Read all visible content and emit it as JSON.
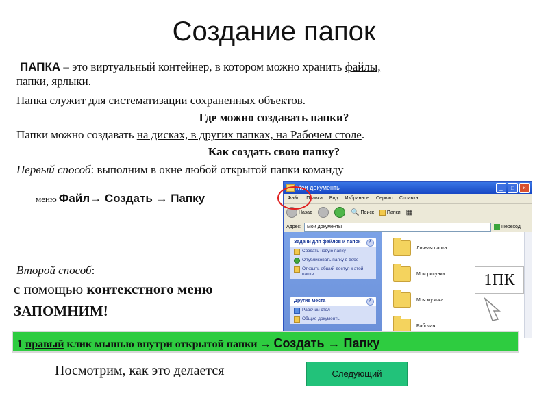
{
  "title": "Создание папок",
  "para1": {
    "term": "ПАПКА",
    "text1": " – это виртуальный контейнер, в котором можно хранить ",
    "link1": "файлы,",
    "link2": "папки, ярлыки",
    "end": "."
  },
  "para2": "Папка служит для систематизации сохраненных объектов.",
  "q1": "Где можно создавать папки?",
  "para3": {
    "text": "Папки можно создавать ",
    "link": "на дисках, в других папках, на Рабочем столе",
    "end": "."
  },
  "q2": "Как создать свою папку?",
  "way1": {
    "label": "Первый способ",
    "text": ": выполним в окне любой открытой папки команду"
  },
  "menu_line": {
    "prefix": "меню",
    "command": "Файл→ Создать → Папку"
  },
  "way2": {
    "label": "Второй способ",
    "colon": ":",
    "line1_plain": "с помощью ",
    "line1_bold": "контекстного меню",
    "remember": "ЗАПОМНИМ!"
  },
  "green_bar": {
    "num": "1 ",
    "right": "правый",
    "text": " клик мышью внутри открытой папки → ",
    "cmd": "Создать → Папку"
  },
  "pk_label": "1ПК",
  "bottom_text": "Посмотрим, как это делается",
  "next_button": "Следующий",
  "explorer": {
    "title": "Мои документы",
    "menu": [
      "Файл",
      "Правка",
      "Вид",
      "Избранное",
      "Сервис",
      "Справка"
    ],
    "toolbar": {
      "back": "Назад",
      "search": "Поиск",
      "folders": "Папки"
    },
    "address_label": "Адрес:",
    "address_value": "Мои документы",
    "go": "Переход",
    "tasks_panel": {
      "header": "Задачи для файлов и папок",
      "items": [
        "Создать новую папку",
        "Опубликовать папку в вебе",
        "Открыть общий доступ к этой папке"
      ]
    },
    "places_panel": {
      "header": "Другие места",
      "items": [
        "Рабочий стол",
        "Общие документы"
      ]
    },
    "folders": [
      "Личная папка",
      "Мои рисунки",
      "Моя музыка",
      "Рабочая"
    ]
  }
}
